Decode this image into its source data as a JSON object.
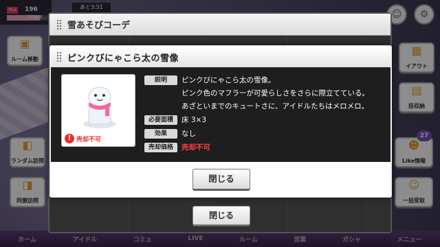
{
  "status": {
    "rank_label": "PLv",
    "level": "196",
    "exp_text": "938/8..",
    "exp_fraction": 0.8,
    "timer": "あと3:51"
  },
  "side_left": [
    {
      "label": "ルーム移動",
      "icon": "door-icon"
    },
    {
      "label": "ランダム訪問",
      "icon": "random-icon"
    },
    {
      "label": "同僚訪問",
      "icon": "colleague-icon"
    }
  ],
  "side_right": [
    {
      "label": "イアウト",
      "icon": "layout-icon"
    },
    {
      "label": "括収納",
      "icon": "storage-icon"
    },
    {
      "label": "Like情報",
      "icon": "like-icon"
    },
    {
      "label": "一括受取",
      "icon": "receive-icon"
    }
  ],
  "like_badge": "27",
  "bottom_nav": [
    "ホーム",
    "アイドル",
    "コミュ",
    "LIVE",
    "ルーム",
    "営業",
    "ガシャ",
    "メニュー"
  ],
  "back_panel": {
    "title": "雪あそびコーデ",
    "close_label": "閉じる"
  },
  "dialog": {
    "title": "ピンクびにゃこら太の雪像",
    "not_for_sale_badge": "売却不可",
    "fields": {
      "description_label": "説明",
      "description_lines": [
        "ピンクびにゃこら太の雪像。",
        "ピンク色のマフラーが可愛らしさをさらに際立てている。",
        "あざといまでのキュートさに、アイドルたちはメロメロ。"
      ],
      "area_label": "必要面積",
      "area_value": "床 3×3",
      "effect_label": "効果",
      "effect_value": "なし",
      "price_label": "売却価格",
      "price_value": "売却不可"
    },
    "close_label": "閉じる"
  },
  "colors": {
    "warning_red": "#e53030",
    "price_red": "#ff4040"
  }
}
